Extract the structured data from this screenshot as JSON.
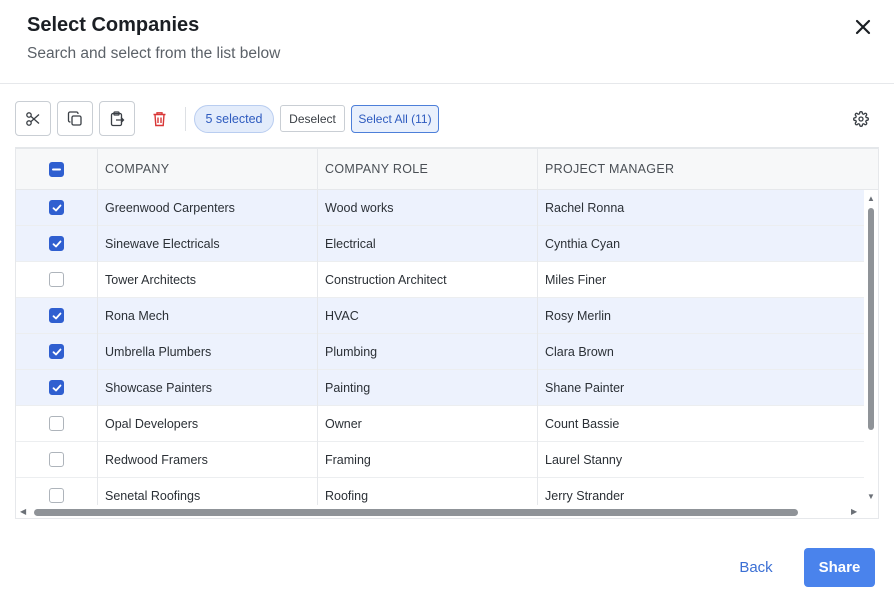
{
  "dialog": {
    "title": "Select Companies",
    "subtitle": "Search and select from the list below"
  },
  "toolbar": {
    "tools": [
      {
        "icon": "scissors-icon",
        "name": "cut-button"
      },
      {
        "icon": "copy-icon",
        "name": "copy-button"
      },
      {
        "icon": "paste-icon",
        "name": "paste-button"
      }
    ],
    "selected_count_label": "5 selected",
    "deselect_label": "Deselect",
    "select_all_label": "Select All (11)",
    "delete_icon": "trash-icon",
    "settings_icon": "gear-icon",
    "delete_color": "#d93636"
  },
  "table": {
    "header_checkbox_state": "indeterminate",
    "columns": [
      "COMPANY",
      "COMPANY ROLE",
      "PROJECT MANAGER"
    ],
    "rows": [
      {
        "company": "Greenwood Carpenters",
        "role": "Wood works",
        "manager": "Rachel Ronna",
        "selected": true
      },
      {
        "company": "Sinewave Electricals",
        "role": "Electrical",
        "manager": "Cynthia Cyan",
        "selected": true
      },
      {
        "company": "Tower Architects",
        "role": "Construction Architect",
        "manager": "Miles Finer",
        "selected": false
      },
      {
        "company": "Rona Mech",
        "role": "HVAC",
        "manager": "Rosy Merlin",
        "selected": true
      },
      {
        "company": "Umbrella Plumbers",
        "role": "Plumbing",
        "manager": "Clara Brown",
        "selected": true
      },
      {
        "company": "Showcase Painters",
        "role": "Painting",
        "manager": "Shane Painter",
        "selected": true
      },
      {
        "company": "Opal Developers",
        "role": "Owner",
        "manager": "Count Bassie",
        "selected": false
      },
      {
        "company": "Redwood Framers",
        "role": "Framing",
        "manager": "Laurel Stanny",
        "selected": false
      },
      {
        "company": "Senetal Roofings",
        "role": "Roofing",
        "manager": "Jerry Strander",
        "selected": false
      }
    ]
  },
  "footer": {
    "back_label": "Back",
    "share_label": "Share"
  },
  "colors": {
    "accent": "#2f5fd0",
    "selected_row": "#edf2fd",
    "primary_button": "#4a83ec"
  }
}
